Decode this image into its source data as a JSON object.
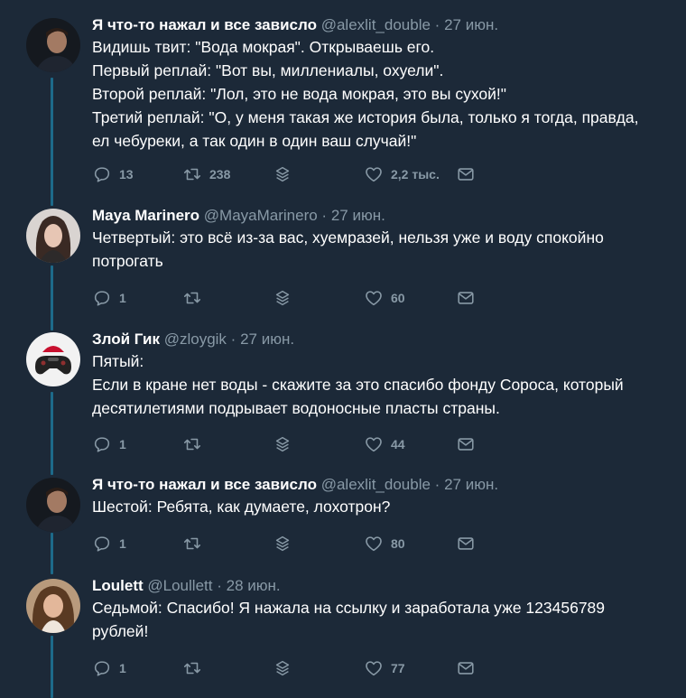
{
  "theme": {
    "background": "#1c2938",
    "thread_line": "#1d6a8a",
    "muted_text": "#8899a6",
    "primary_text": "#ffffff"
  },
  "icons": {
    "reply": "reply-icon",
    "retweet": "retweet-icon",
    "stack": "stack-icon",
    "like": "heart-icon",
    "message": "message-icon"
  },
  "tweets": [
    {
      "name": "Я что-то нажал и все зависло",
      "handle": "@alexlit_double",
      "separator": "·",
      "date": "27 июн.",
      "lines": [
        "Видишь твит: \"Вода мокрая\". Открываешь его.",
        "Первый реплай: \"Вот вы, миллениалы, охуели\".",
        "Второй реплай: \"Лол, это не вода мокрая, это вы сухой!\"",
        "Третий реплай: \"О, у меня такая же история была, только я тогда, правда,",
        "ел чебуреки, а так один в один ваш случай!\""
      ],
      "replies": "13",
      "retweets": "238",
      "likes": "2,2 тыс."
    },
    {
      "name": "Maya Marinero",
      "handle": "@MayaMarinero",
      "separator": "·",
      "date": "27 июн.",
      "lines": [
        "Четвертый: это всё из-за вас, хуемразей, нельзя уже и воду спокойно",
        "потрогать"
      ],
      "replies": "1",
      "retweets": "",
      "likes": "60"
    },
    {
      "name": "Злой Гик",
      "handle": "@zloygik",
      "separator": "·",
      "date": "27 июн.",
      "lines": [
        "Пятый:",
        "Если в кране нет воды - скажите за это спасибо фонду Сороса, который",
        "десятилетиями подрывает водоносные пласты страны."
      ],
      "replies": "1",
      "retweets": "",
      "likes": "44"
    },
    {
      "name": "Я что-то нажал и все зависло",
      "handle": "@alexlit_double",
      "separator": "·",
      "date": "27 июн.",
      "lines": [
        "Шестой: Ребята, как думаете, лохотрон?"
      ],
      "replies": "1",
      "retweets": "",
      "likes": "80"
    },
    {
      "name": "Loulett",
      "handle": "@Loullett",
      "separator": "·",
      "date": "28 июн.",
      "lines": [
        "Седьмой: Спасибо! Я нажала на ссылку и заработала уже 123456789",
        "рублей!"
      ],
      "replies": "1",
      "retweets": "",
      "likes": "77"
    }
  ]
}
